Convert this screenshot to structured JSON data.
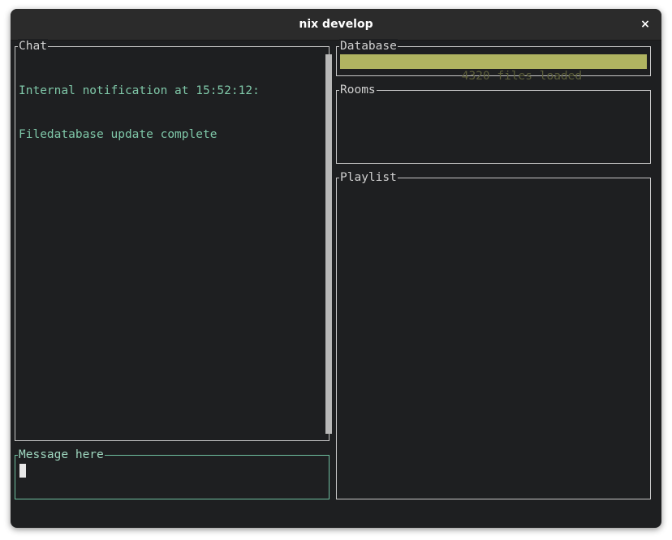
{
  "window": {
    "title": "nix develop",
    "close_glyph": "×"
  },
  "chat": {
    "label": "Chat",
    "lines": [
      "Internal notification at 15:52:12:",
      "Filedatabase update complete"
    ]
  },
  "message": {
    "label": "Message here",
    "value": ""
  },
  "database": {
    "label": "Database",
    "status": "4320 files loaded",
    "progress_percent": 100
  },
  "rooms": {
    "label": "Rooms",
    "items": []
  },
  "playlist": {
    "label": "Playlist",
    "items": []
  },
  "colors": {
    "background": "#1e1f21",
    "chat_text": "#7fc7a8",
    "focus_border": "#6fbfa0",
    "progress_fill": "#b0b461"
  }
}
